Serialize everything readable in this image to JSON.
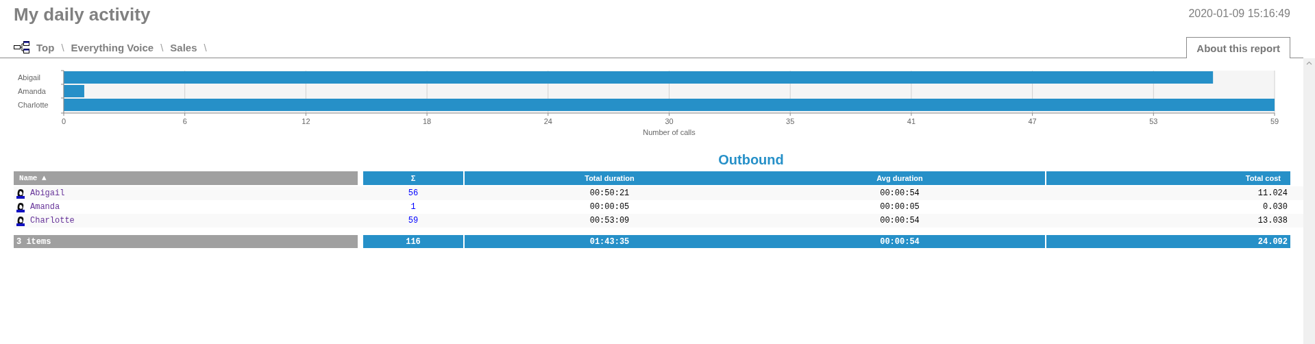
{
  "header": {
    "title": "My daily activity",
    "timestamp": "2020-01-09 15:16:49"
  },
  "breadcrumb": [
    {
      "label": "Top",
      "separator": "\\"
    },
    {
      "label": "Everything Voice",
      "separator": "\\"
    },
    {
      "label": "Sales",
      "separator": "\\"
    }
  ],
  "about_button": "About this report",
  "chart": {
    "chart_data": {
      "type": "bar",
      "orientation": "horizontal",
      "xlabel": "Number of calls",
      "categories": [
        "Abigail",
        "Amanda",
        "Charlotte"
      ],
      "series": [
        {
          "color": "#2690c8",
          "values": [
            56,
            1,
            59
          ]
        }
      ],
      "xlim": [
        0,
        59
      ],
      "grid": true,
      "xticks": [
        {
          "value": 0,
          "label": "0"
        },
        {
          "value": 5.9,
          "label": "6"
        },
        {
          "value": 11.8,
          "label": "12"
        },
        {
          "value": 17.7,
          "label": "18"
        },
        {
          "value": 23.6,
          "label": "24"
        },
        {
          "value": 29.5,
          "label": "30"
        },
        {
          "value": 35.4,
          "label": "35"
        },
        {
          "value": 41.3,
          "label": "41"
        },
        {
          "value": 47.2,
          "label": "47"
        },
        {
          "value": 53.1,
          "label": "53"
        },
        {
          "value": 59,
          "label": "59"
        }
      ]
    }
  },
  "table": {
    "title": "Outbound",
    "columns": [
      {
        "label": "Name ▲",
        "kind": "name"
      },
      {
        "label": "Σ",
        "kind": "count"
      },
      {
        "label": "Total duration",
        "kind": "duration"
      },
      {
        "label": "Avg duration",
        "kind": "avg"
      },
      {
        "label": "Total cost",
        "kind": "cost"
      }
    ],
    "rows": [
      {
        "name": "Abigail",
        "count": "56",
        "total_duration": "00:50:21",
        "avg_duration": "00:00:54",
        "total_cost": "11.024"
      },
      {
        "name": "Amanda",
        "count": "1",
        "total_duration": "00:00:05",
        "avg_duration": "00:00:05",
        "total_cost": "0.030"
      },
      {
        "name": "Charlotte",
        "count": "59",
        "total_duration": "00:53:09",
        "avg_duration": "00:00:54",
        "total_cost": "13.038"
      }
    ],
    "footer": {
      "name": "3 items",
      "count": "116",
      "total_duration": "01:43:35",
      "avg_duration": "00:00:54",
      "total_cost": "24.092"
    }
  }
}
